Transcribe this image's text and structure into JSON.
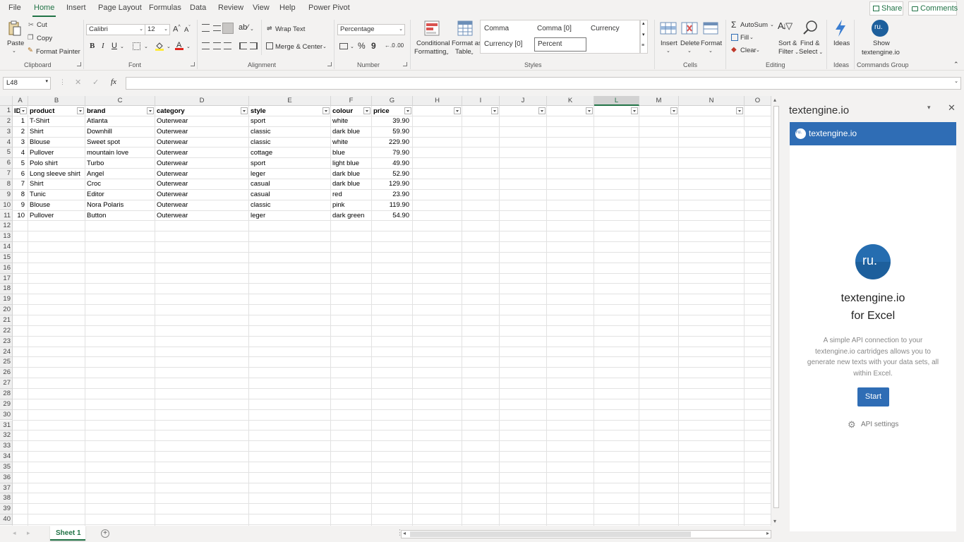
{
  "menu": {
    "tabs": [
      "File",
      "Home",
      "Insert",
      "Page Layout",
      "Formulas",
      "Data",
      "Review",
      "View",
      "Help",
      "Power Pivot"
    ],
    "active": "Home",
    "share": "Share",
    "comments": "Comments"
  },
  "ribbon": {
    "clipboard": {
      "paste": "Paste",
      "cut": "Cut",
      "copy": "Copy",
      "format_painter": "Format Painter",
      "label": "Clipboard"
    },
    "font": {
      "name": "Calibri",
      "size": "12",
      "bold": "B",
      "italic": "I",
      "underline": "U",
      "grow": "A",
      "shrink": "A",
      "label": "Font"
    },
    "alignment": {
      "wrap_text": "Wrap Text",
      "merge_center": "Merge & Center",
      "label": "Alignment"
    },
    "number": {
      "format": "Percentage",
      "percent": "%",
      "comma": "9",
      "label": "Number"
    },
    "styles": {
      "conditional": "Conditional",
      "conditional2": "Formatting",
      "format_table": "Format as",
      "format_table2": "Table",
      "items": [
        "Comma",
        "Comma [0]",
        "Currency",
        "Currency [0]",
        "Percent"
      ],
      "label": "Styles"
    },
    "cells": {
      "insert": "Insert",
      "delete": "Delete",
      "format": "Format",
      "label": "Cells"
    },
    "editing": {
      "autosum": "AutoSum",
      "fill": "Fill",
      "clear": "Clear",
      "sort_filter": "Sort &",
      "sort_filter2": "Filter",
      "find_select": "Find &",
      "find_select2": "Select",
      "label": "Editing"
    },
    "ideas": {
      "ideas": "Ideas",
      "label": "Ideas"
    },
    "commands": {
      "show": "Show",
      "show2": "textengine.io",
      "label": "Commands Group"
    }
  },
  "formula_bar": {
    "name_box": "L48",
    "fx": "fx",
    "value": ""
  },
  "columns": [
    "A",
    "B",
    "C",
    "D",
    "E",
    "F",
    "G",
    "H",
    "I",
    "J",
    "K",
    "L",
    "M",
    "N",
    "O"
  ],
  "selected_column": "L",
  "headers": [
    "ID",
    "product",
    "brand",
    "category",
    "style",
    "colour",
    "price"
  ],
  "rows": [
    [
      "1",
      "T-Shirt",
      "Atlanta",
      "Outerwear",
      "sport",
      "white",
      "39.90"
    ],
    [
      "2",
      "Shirt",
      "Downhill",
      "Outerwear",
      "classic",
      "dark blue",
      "59.90"
    ],
    [
      "3",
      "Blouse",
      "Sweet spot",
      "Outerwear",
      "classic",
      "white",
      "229.90"
    ],
    [
      "4",
      "Pullover",
      "mountain love",
      "Outerwear",
      "cottage",
      "blue",
      "79.90"
    ],
    [
      "5",
      "Polo shirt",
      "Turbo",
      "Outerwear",
      "sport",
      "light blue",
      "49.90"
    ],
    [
      "6",
      "Long sleeve shirt",
      "Angel",
      "Outerwear",
      "leger",
      "dark blue",
      "52.90"
    ],
    [
      "7",
      "Shirt",
      "Croc",
      "Outerwear",
      "casual",
      "dark blue",
      "129.90"
    ],
    [
      "8",
      "Tunic",
      "Editor",
      "Outerwear",
      "casual",
      "red",
      "23.90"
    ],
    [
      "9",
      "Blouse",
      "Nora Polaris",
      "Outerwear",
      "classic",
      "pink",
      "119.90"
    ],
    [
      "10",
      "Pullover",
      "Button",
      "Outerwear",
      "leger",
      "dark green",
      "54.90"
    ]
  ],
  "row_numbers": [
    "1",
    "2",
    "3",
    "4",
    "5",
    "6",
    "7",
    "8",
    "9",
    "10",
    "11",
    "12",
    "13",
    "14",
    "15",
    "16",
    "17",
    "18",
    "19",
    "20",
    "21",
    "22",
    "23",
    "24",
    "25",
    "26",
    "27",
    "28",
    "29",
    "30",
    "31",
    "32",
    "33",
    "34",
    "35",
    "36",
    "37",
    "38",
    "39",
    "40"
  ],
  "sheet_tabs": [
    "Sheet 1"
  ],
  "pane": {
    "title": "textengine.io",
    "brand_bar": "textengine.io",
    "logo_text": "ru.",
    "heading": "textengine.io",
    "heading2": "for Excel",
    "description": "A simple API connection to your textengine.io cartridges allows you to generate new texts with your data sets, all within Excel.",
    "start": "Start",
    "api_settings": "API settings"
  },
  "colors": {
    "excel_green": "#217346",
    "pane_blue": "#2f6db5",
    "logo_blue": "#1d5f9c"
  }
}
